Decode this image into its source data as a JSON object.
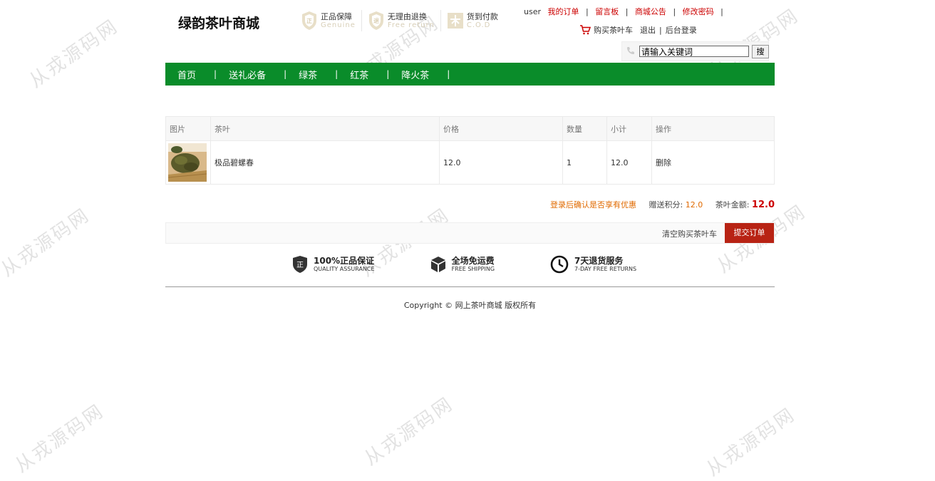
{
  "site": {
    "logo": "绿韵茶叶商城"
  },
  "badges": [
    {
      "title": "正品保障",
      "sub": "Genuine"
    },
    {
      "title": "无理由退换",
      "sub": "Free return"
    },
    {
      "title": "货到付款",
      "sub": "C.O.D"
    }
  ],
  "topnav": {
    "username": "user",
    "links": [
      "我的订单",
      "留言板",
      "商城公告",
      "修改密码"
    ],
    "cart": "购买茶叶车",
    "logout": "退出",
    "admin": "后台登录"
  },
  "search": {
    "value": "请输入关键词",
    "button": "搜"
  },
  "mainnav": [
    "首页",
    "送礼必备",
    "绿茶",
    "红茶",
    "降火茶"
  ],
  "table": {
    "headers": [
      "图片",
      "茶叶",
      "价格",
      "数量",
      "小计",
      "操作"
    ],
    "rows": [
      {
        "name": "极品碧螺春",
        "price": "12.0",
        "qty": "1",
        "subtotal": "12.0",
        "action": "删除"
      }
    ]
  },
  "summary": {
    "promo": "登录后确认是否享有优惠",
    "points_label": "赠送积分:",
    "points": "12.0",
    "amount_label": "茶叶金额:",
    "amount": "12.0"
  },
  "actions": {
    "clear": "清空购买茶叶车",
    "submit": "提交订单"
  },
  "features": [
    {
      "title": "100%正品保证",
      "sub": "QUALITY ASSURANCE",
      "icon": "shield-icon"
    },
    {
      "title": "全场免运费",
      "sub": "FREE SHIPPING",
      "icon": "box-icon"
    },
    {
      "title": "7天退货服务",
      "sub": "7-DAY FREE RETURNS",
      "icon": "clock-icon"
    }
  ],
  "footer": {
    "copyright": "Copyright © 网上茶叶商城 版权所有"
  },
  "watermark": "从戎源码网",
  "colors": {
    "nav_green": "#0a8c2a",
    "accent_red": "#cc0000",
    "submit_red": "#b82314",
    "promo_orange": "#e06a00"
  }
}
